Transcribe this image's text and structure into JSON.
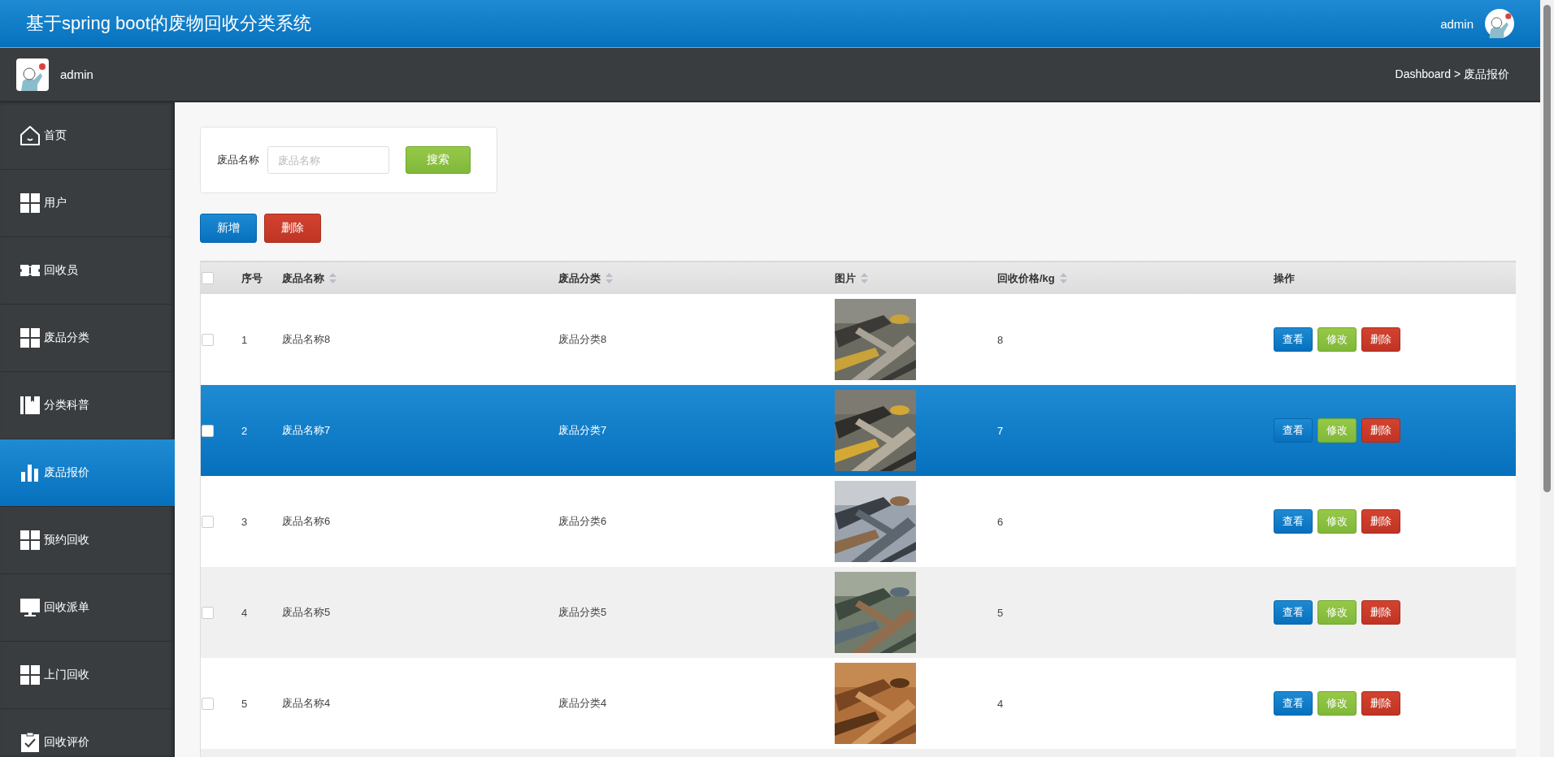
{
  "header": {
    "title": "基于spring boot的废物回收分类系统",
    "user": "admin"
  },
  "subheader": {
    "user": "admin",
    "breadcrumb": "Dashboard > 废品报价"
  },
  "sidebar": {
    "items": [
      {
        "label": "首页",
        "selected": false
      },
      {
        "label": "用户",
        "selected": false
      },
      {
        "label": "回收员",
        "selected": false
      },
      {
        "label": "废品分类",
        "selected": false
      },
      {
        "label": "分类科普",
        "selected": false
      },
      {
        "label": "废品报价",
        "selected": true
      },
      {
        "label": "预约回收",
        "selected": false
      },
      {
        "label": "回收派单",
        "selected": false
      },
      {
        "label": "上门回收",
        "selected": false
      },
      {
        "label": "回收评价",
        "selected": false
      }
    ]
  },
  "search": {
    "label": "废品名称",
    "placeholder": "废品名称",
    "button": "搜索"
  },
  "actions": {
    "add": "新增",
    "delete": "删除"
  },
  "table": {
    "select_all": {
      "checked": false
    },
    "columns": [
      {
        "label": "序号",
        "sortable": false
      },
      {
        "label": "废品名称",
        "sortable": true
      },
      {
        "label": "废品分类",
        "sortable": true
      },
      {
        "label": "图片",
        "sortable": true
      },
      {
        "label": "回收价格/kg",
        "sortable": true
      },
      {
        "label": "操作",
        "sortable": false
      }
    ],
    "rows": [
      {
        "checked": false,
        "selected": false,
        "index": "1",
        "name": "废品名称8",
        "category": "废品分类8",
        "price": "8",
        "buttons": [
          "查看",
          "修改",
          "删除"
        ]
      },
      {
        "checked": false,
        "selected": true,
        "index": "2",
        "name": "废品名称7",
        "category": "废品分类7",
        "price": "7",
        "buttons": [
          "查看",
          "修改",
          "删除"
        ]
      },
      {
        "checked": false,
        "selected": false,
        "index": "3",
        "name": "废品名称6",
        "category": "废品分类6",
        "price": "6",
        "buttons": [
          "查看",
          "修改",
          "删除"
        ]
      },
      {
        "checked": false,
        "selected": false,
        "index": "4",
        "name": "废品名称5",
        "category": "废品分类5",
        "price": "5",
        "buttons": [
          "查看",
          "修改",
          "删除"
        ]
      },
      {
        "checked": false,
        "selected": false,
        "index": "5",
        "name": "废品名称4",
        "category": "废品分类4",
        "price": "4",
        "buttons": [
          "查看",
          "修改",
          "删除"
        ]
      }
    ]
  }
}
